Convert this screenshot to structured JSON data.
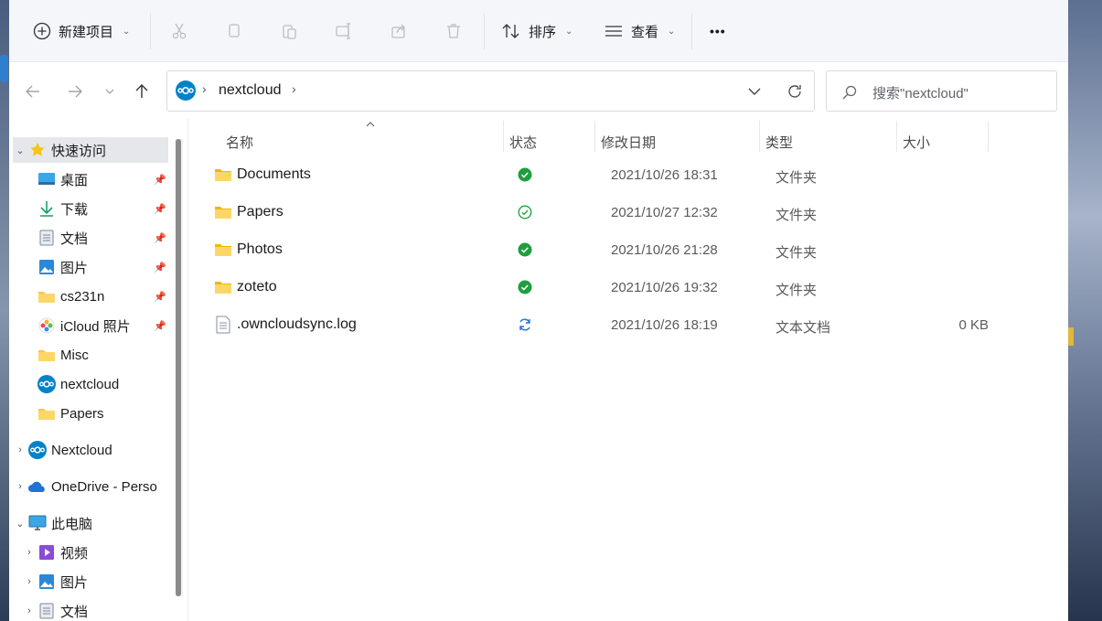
{
  "ribbon": {
    "new_label": "新建项目",
    "sort_label": "排序",
    "view_label": "查看",
    "more_label": "•••"
  },
  "address": {
    "path": "nextcloud"
  },
  "search": {
    "placeholder": "搜索\"nextcloud\""
  },
  "sidebar": {
    "quick_access": "快速访问",
    "items": [
      {
        "label": "桌面",
        "pinned": true
      },
      {
        "label": "下载",
        "pinned": true
      },
      {
        "label": "文档",
        "pinned": true
      },
      {
        "label": "图片",
        "pinned": true
      },
      {
        "label": "cs231n",
        "pinned": true
      },
      {
        "label": "iCloud 照片",
        "pinned": true
      },
      {
        "label": "Misc",
        "pinned": false
      },
      {
        "label": "nextcloud",
        "pinned": false
      },
      {
        "label": "Papers",
        "pinned": false
      }
    ],
    "nextcloud": "Nextcloud",
    "onedrive": "OneDrive - Perso",
    "this_pc": "此电脑",
    "pc_items": [
      {
        "label": "视频"
      },
      {
        "label": "图片"
      },
      {
        "label": "文档"
      }
    ]
  },
  "columns": {
    "name": "名称",
    "status": "状态",
    "modified": "修改日期",
    "type": "类型",
    "size": "大小"
  },
  "files": [
    {
      "name": "Documents",
      "status": "synced",
      "modified": "2021/10/26 18:31",
      "type": "文件夹",
      "size": ""
    },
    {
      "name": "Papers",
      "status": "available",
      "modified": "2021/10/27 12:32",
      "type": "文件夹",
      "size": ""
    },
    {
      "name": "Photos",
      "status": "synced",
      "modified": "2021/10/26 21:28",
      "type": "文件夹",
      "size": ""
    },
    {
      "name": "zoteto",
      "status": "synced",
      "modified": "2021/10/26 19:32",
      "type": "文件夹",
      "size": ""
    },
    {
      "name": ".owncloudsync.log",
      "status": "syncing",
      "modified": "2021/10/26 18:19",
      "type": "文本文档",
      "size": "0 KB"
    }
  ],
  "colors": {
    "accent": "#0078d4",
    "folder": "#f7c54b",
    "sync_green": "#1e9e3e",
    "nextcloud_blue": "#0082c9"
  }
}
